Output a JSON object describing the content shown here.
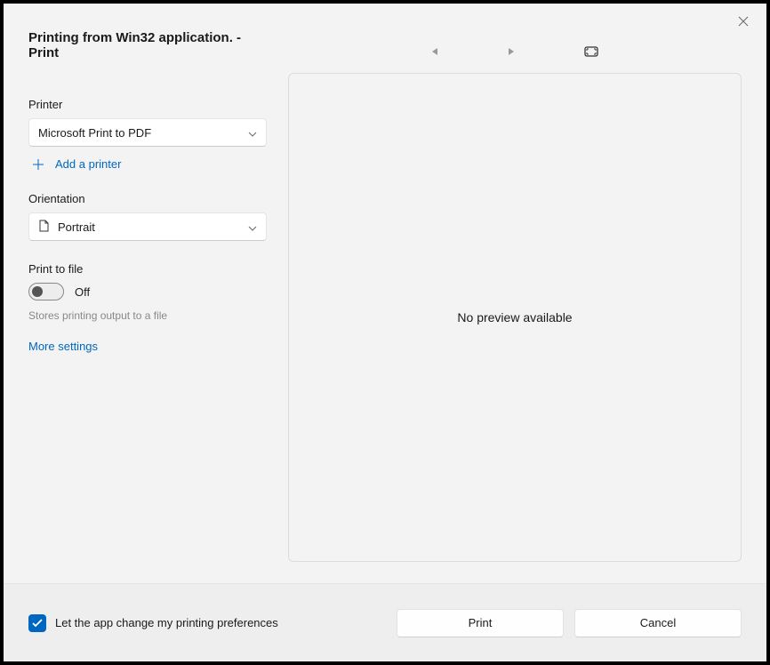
{
  "title": "Printing from Win32 application. - Print",
  "printer": {
    "label": "Printer",
    "selected": "Microsoft Print to PDF",
    "add_link": "Add a printer"
  },
  "orientation": {
    "label": "Orientation",
    "selected": "Portrait"
  },
  "print_to_file": {
    "label": "Print to file",
    "state_label": "Off",
    "hint": "Stores printing output to a file"
  },
  "more_settings": "More settings",
  "preview": {
    "message": "No preview available"
  },
  "footer": {
    "checkbox_label": "Let the app change my printing preferences",
    "print_label": "Print",
    "cancel_label": "Cancel"
  }
}
